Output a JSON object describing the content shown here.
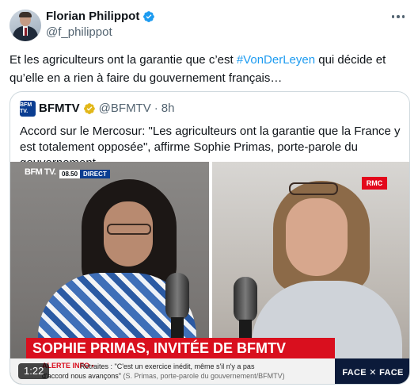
{
  "author": {
    "display_name": "Florian Philippot",
    "handle": "@f_philippot"
  },
  "tweet": {
    "text_before": "Et les agriculteurs ont la garantie que c’est ",
    "hashtag": "#VonDerLeyen",
    "text_after": " qui décide et qu’elle en a rien à faire du gouvernement français…"
  },
  "quote": {
    "name": "BFMTV",
    "handle": "@BFMTV",
    "separator": "·",
    "time": "8h",
    "avatar_label": "BFM TV.",
    "text": "Accord sur le Mercosur: \"Les agriculteurs ont la garantie que la France y est totalement opposée\", affirme Sophie Primas, porte-parole du gouvernement"
  },
  "video": {
    "channel_logo": "BFM TV.",
    "clock": "08.50",
    "live_label": "DIRECT",
    "rmc_logo": "RMC",
    "headline": "SOPHIE PRIMAS, INVITÉE DE BFMTV",
    "ticker_label": "ALERTE INFO •",
    "ticker_text": "Retraites : \"C'est un exercice inédit, même s'il n'y a pas",
    "ticker_line2": "d'accord nous avançons\"",
    "ticker_attribution": "(S. Primas, porte-parole du gouvernement/BFMTV)",
    "show_logo": "FACE ✕ FACE",
    "duration": "1:22"
  },
  "colors": {
    "link": "#1d9bf0",
    "verified": "#1d9bf0",
    "business_verified": "#e2b719",
    "bfm_red": "#d90f1e"
  }
}
